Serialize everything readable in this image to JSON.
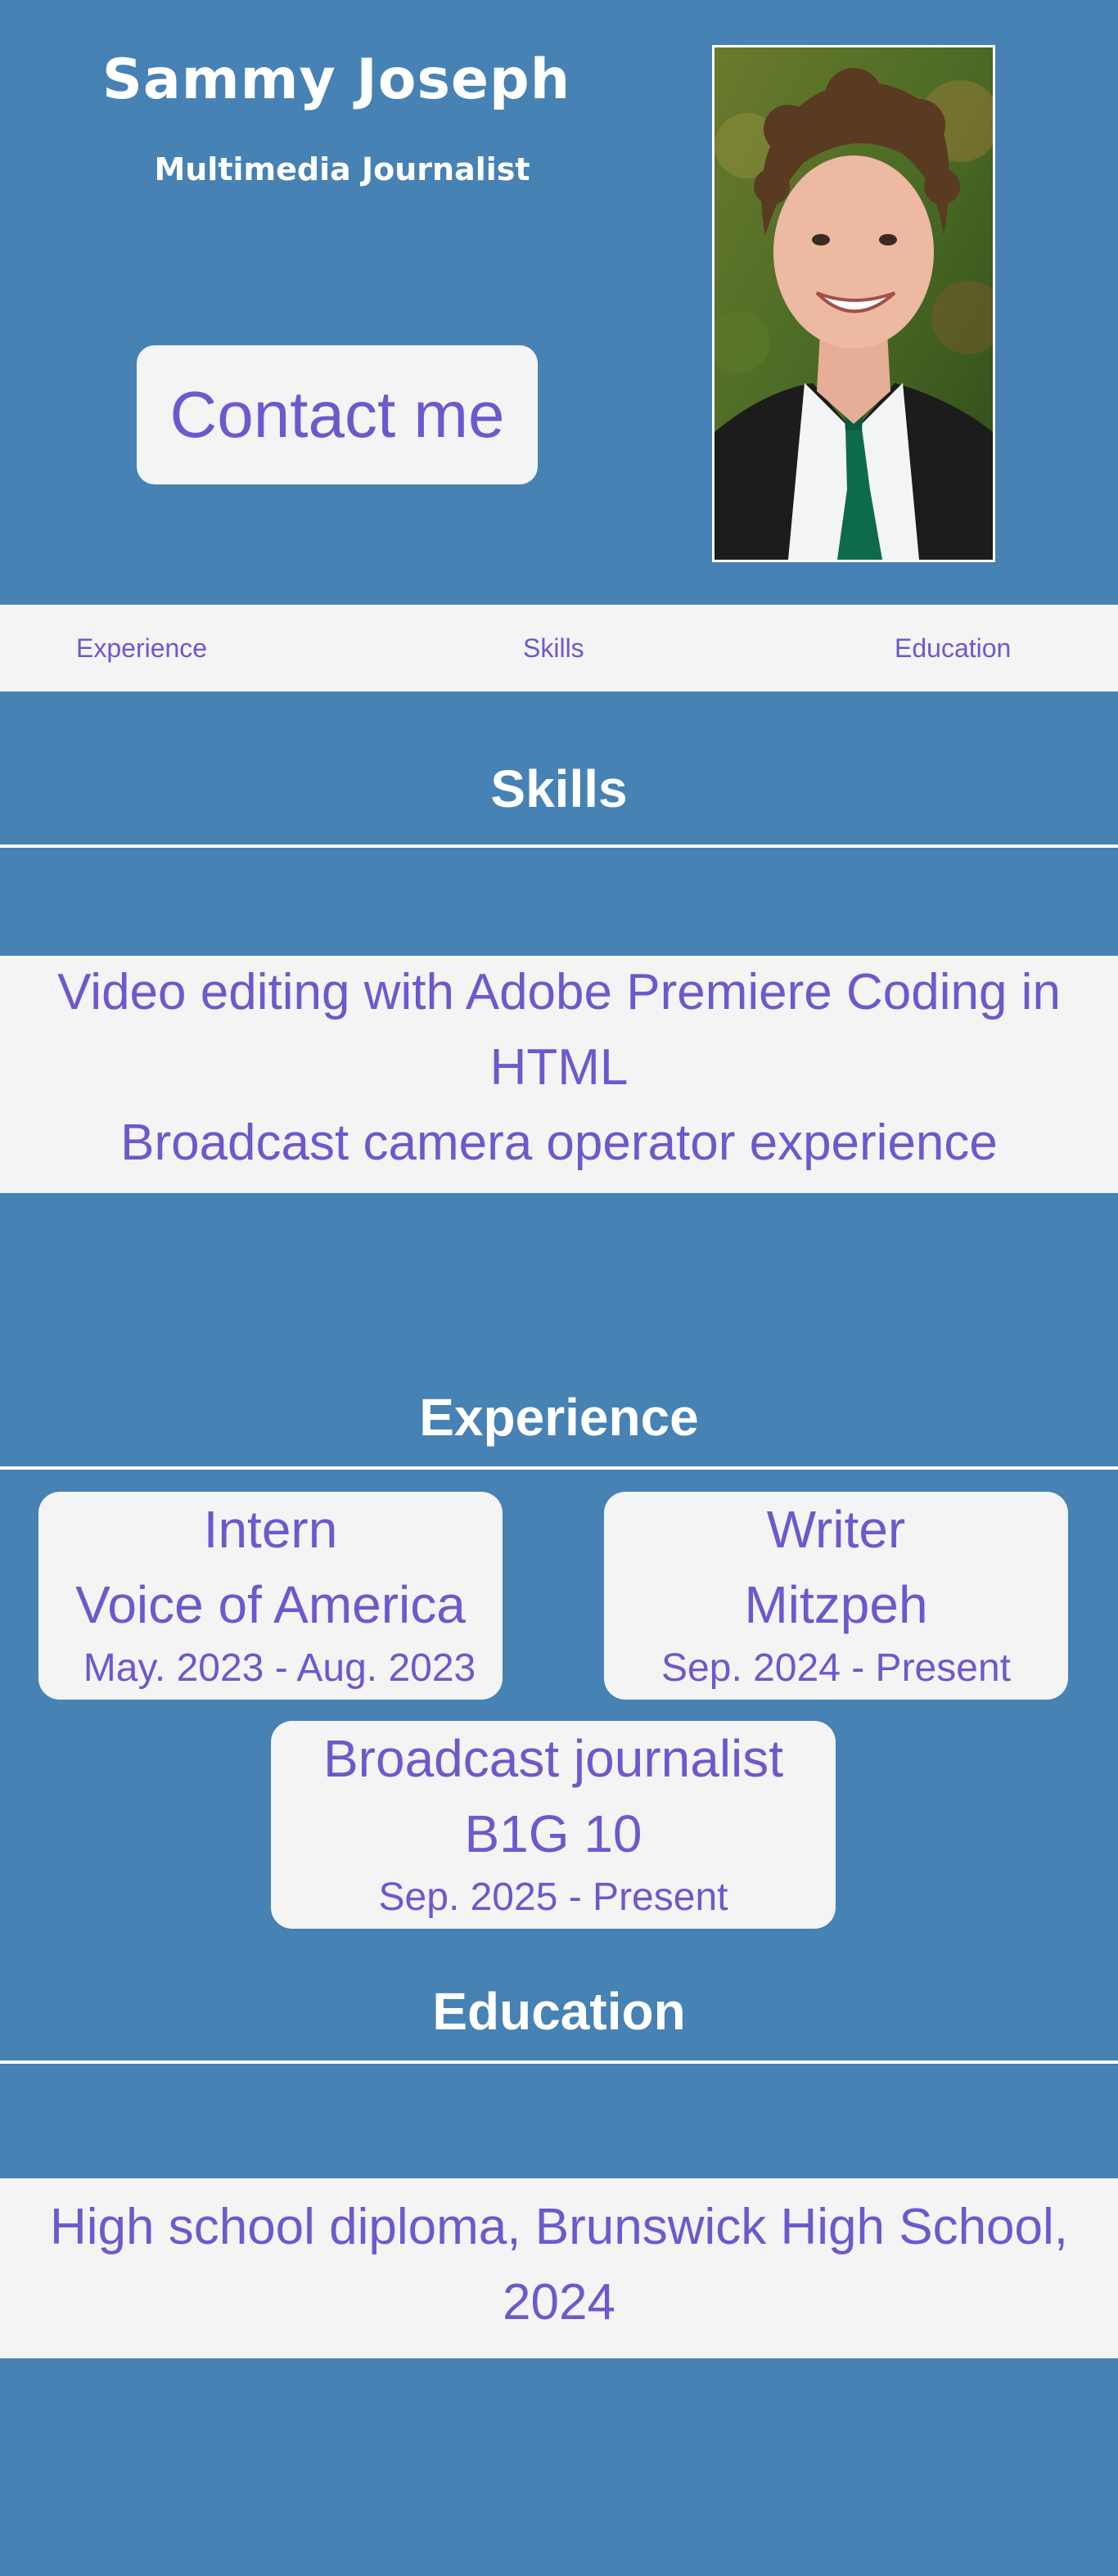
{
  "header": {
    "name": "Sammy Joseph",
    "role": "Multimedia Journalist",
    "contact_label": "Contact me"
  },
  "nav": {
    "items": [
      {
        "label": "Experience"
      },
      {
        "label": "Skills"
      },
      {
        "label": "Education"
      }
    ]
  },
  "skills": {
    "title": "Skills",
    "lines": [
      "Video editing with Adobe Premiere Coding in",
      "HTML",
      "Broadcast camera operator experience"
    ]
  },
  "experience": {
    "title": "Experience",
    "jobs": [
      {
        "title": "Intern",
        "org": "Voice of America",
        "dates": "May. 2023 - Aug. 2023"
      },
      {
        "title": "Writer",
        "org": "Mitzpeh",
        "dates": "Sep. 2024 - Present"
      },
      {
        "title": "Broadcast journalist",
        "org": "B1G 10",
        "dates": "Sep. 2025 - Present"
      }
    ]
  },
  "education": {
    "title": "Education",
    "lines": [
      "High school diploma, Brunswick High School,",
      "2024"
    ]
  },
  "colors": {
    "background": "#4682b4",
    "panel": "#f4f4f4",
    "accent_text": "#6a5acd",
    "heading_text": "#ffffff"
  }
}
